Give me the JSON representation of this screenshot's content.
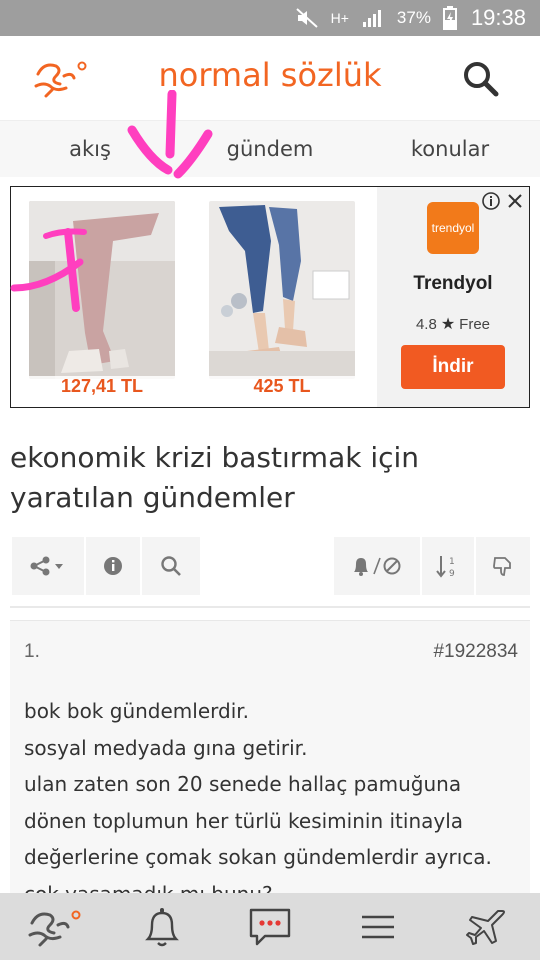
{
  "status": {
    "battery_pct": "37%",
    "time": "19:38",
    "network": "H+"
  },
  "header": {
    "title": "normal sözlük"
  },
  "tabs": [
    {
      "label": "akış"
    },
    {
      "label": "gündem"
    },
    {
      "label": "konular"
    }
  ],
  "ad": {
    "products": [
      {
        "price": "127,41 TL"
      },
      {
        "price": "425 TL"
      }
    ],
    "app": {
      "icon_text": "trendyol",
      "name": "Trendyol",
      "rating": "4.8",
      "price_type": "Free",
      "install_label": "İndir"
    }
  },
  "topic": {
    "title": "ekonomik krizi bastırmak için yaratılan gündemler"
  },
  "entry": {
    "number": "1.",
    "id": "#1922834",
    "lines": [
      "bok bok gündemlerdir.",
      "sosyal medyada gına getirir.",
      "ulan zaten son 20 senede hallaç pamuğuna",
      "dönen toplumun her türlü kesiminin itinayla",
      "değerlerine çomak sokan gündemlerdir ayrıca.",
      "çok yaşamadık mı bunu?"
    ]
  },
  "colors": {
    "accent": "#f26522",
    "install": "#f15a22",
    "annotation": "#ff3fbf"
  },
  "icons": [
    "mute-icon",
    "signal-icon",
    "battery-icon",
    "search-icon",
    "info-icon",
    "close-icon",
    "share-icon",
    "bell-icon",
    "block-icon",
    "sort-icon",
    "chat-icon",
    "menu-icon",
    "plane-icon"
  ]
}
